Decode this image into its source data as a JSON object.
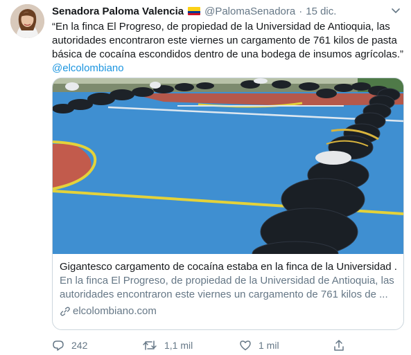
{
  "author": {
    "name": "Senadora Paloma Valencia",
    "handle": "@PalomaSenadora",
    "separator": "·",
    "date": "15 dic."
  },
  "tweet": {
    "lines": [
      "“En la finca El Progreso, de propiedad de la Universidad de Antioquia, las",
      "autoridades encontraron este viernes un cargamento de 761 kilos de pasta",
      "básica de cocaína escondidos dentro de una bodega de insumos agrícolas.”"
    ],
    "mention": "@elcolombiano"
  },
  "card": {
    "title": "Gigantesco cargamento de cocaína estaba en la finca de la Universidad ...",
    "desc_lines": [
      "En la finca El Progreso, de propiedad de la Universidad de Antioquia, las",
      "autoridades encontraron este viernes un cargamento de 761 kilos de ..."
    ],
    "domain": "elcolombiano.com"
  },
  "actions": {
    "replies": "242",
    "retweets": "1,1 mil",
    "likes": "1 mil"
  },
  "colors": {
    "link": "#1b95e0",
    "muted": "#657786",
    "flag": [
      "#fcd116",
      "#003893",
      "#ce1126"
    ]
  }
}
